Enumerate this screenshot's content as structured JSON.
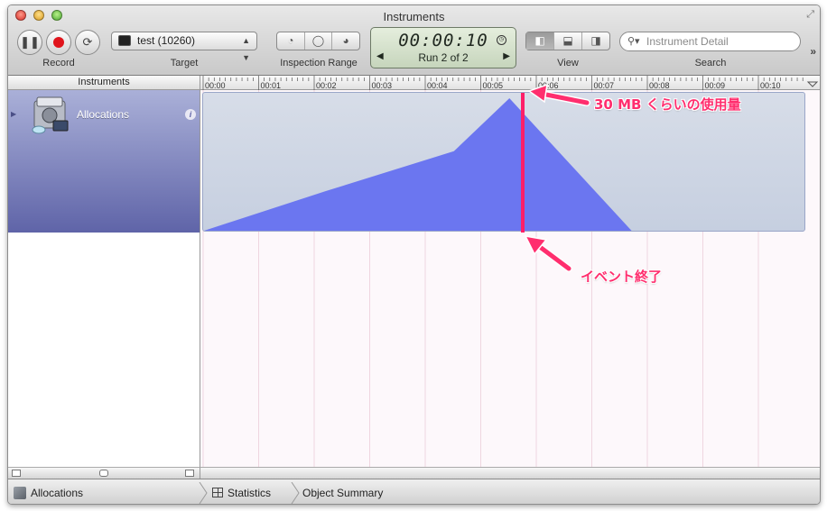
{
  "window": {
    "title": "Instruments"
  },
  "toolbar": {
    "record_label": "Record",
    "target_label": "Target",
    "target_value": "test (10260)",
    "inspection_range_label": "Inspection Range",
    "view_label": "View",
    "search_label": "Search",
    "search_placeholder": "Instrument Detail",
    "time": "00:00:10",
    "run": "Run 2 of 2"
  },
  "instruments_header": "Instruments",
  "ruler_ticks": [
    "00:00",
    "00:01",
    "00:02",
    "00:03",
    "00:04",
    "00:05",
    "00:06",
    "00:07",
    "00:08",
    "00:09",
    "00:10"
  ],
  "instrument": {
    "name": "Allocations"
  },
  "statusbar": {
    "instrument": "Allocations",
    "statistics": "Statistics",
    "object_summary": "Object Summary"
  },
  "annotations": {
    "peak": "30 MB くらいの使用量",
    "event_end": "イベント終了"
  },
  "colors": {
    "graph_fill": "#6b76f0",
    "marker": "#ff1f68",
    "annotation": "#ff2e6e",
    "selected_row": "#7a80c0"
  },
  "chart_data": {
    "type": "area",
    "x": [
      0,
      2.2,
      4.5,
      5.5,
      7.7
    ],
    "values": [
      0,
      30,
      60,
      100,
      0
    ]
  }
}
